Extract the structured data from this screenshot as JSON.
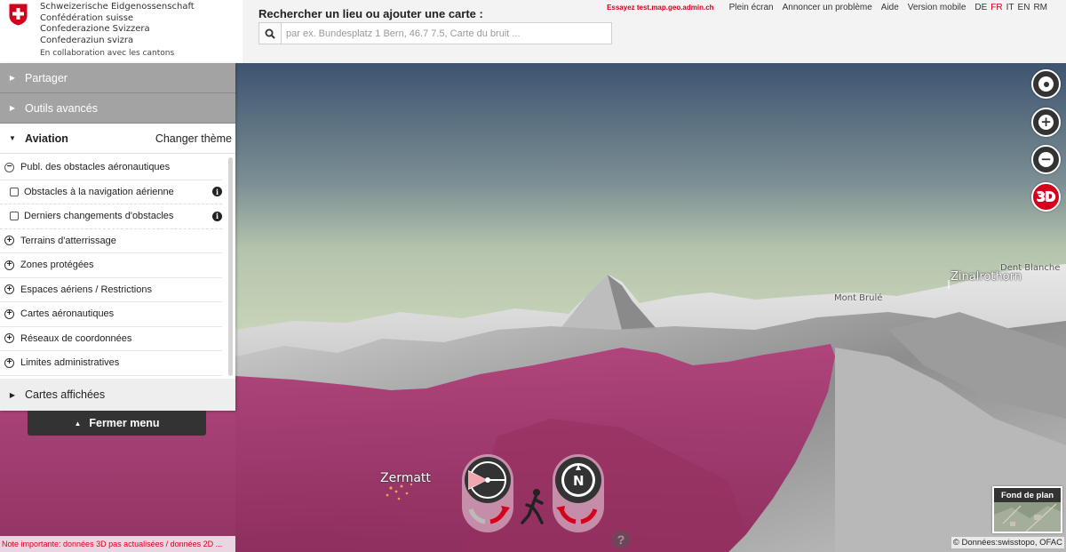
{
  "header": {
    "agency_lines": [
      "Schweizerische Eidgenossenschaft",
      "Confédération suisse",
      "Confederazione Svizzera",
      "Confederaziun svizra"
    ],
    "collaboration": "En collaboration avec les cantons",
    "search_label": "Rechercher un lieu ou ajouter une carte :",
    "search_placeholder": "par ex. Bundesplatz 1 Bern, 46.7 7.5, Carte du bruit ...",
    "try_link": "Essayez test.map.geo.admin.ch",
    "links": [
      "Plein écran",
      "Annoncer un problème",
      "Aide",
      "Version mobile"
    ],
    "languages": [
      "DE",
      "FR",
      "IT",
      "EN",
      "RM"
    ],
    "active_language": "FR"
  },
  "panel": {
    "share": "Partager",
    "advanced_tools": "Outils avancés",
    "theme": "Aviation",
    "change_theme": "Changer thème",
    "tree": {
      "group_open": "Publ. des obstacles aéronautiques",
      "sub_items": [
        "Obstacles à la navigation aérienne",
        "Derniers changements d'obstacles"
      ],
      "groups": [
        "Terrains d'atterrissage",
        "Zones protégées",
        "Espaces aériens / Restrictions",
        "Cartes aéronautiques",
        "Réseaux de coordonnées",
        "Limites administratives"
      ]
    },
    "displayed_maps": "Cartes affichées",
    "close_menu": "Fermer menu"
  },
  "map": {
    "labels": {
      "zermatt": "Zermatt",
      "zinalrothorn": "Zinalrothorn",
      "dent_blanche": "Dent Blanche",
      "mont_brule": "Mont Brulé"
    },
    "control_3d": "3D",
    "help": "?",
    "basemap_label": "Fond de plan",
    "attribution": "© Données:swisstopo, OFAC",
    "note": "Note importante: données 3D pas actualisées / données 2D ..."
  },
  "colors": {
    "accent": "#d6001c",
    "panel_grey": "#a3a3a3",
    "airspace_magenta": "#a8336e",
    "sky_top": "#3d5470",
    "sky_bottom": "#c6d4b8"
  }
}
